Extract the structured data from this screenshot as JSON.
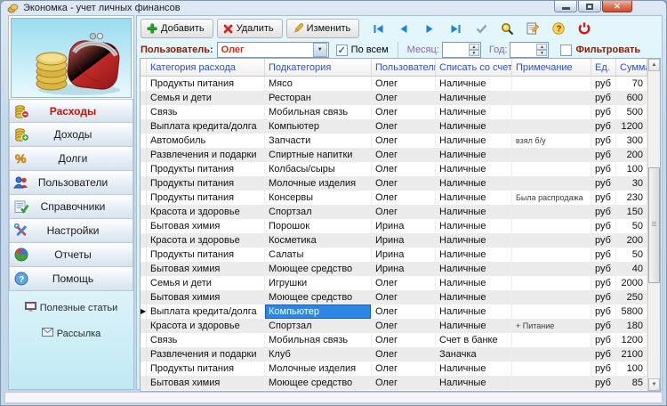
{
  "window": {
    "title": "Экономка - учет личных финансов"
  },
  "toolbar": {
    "buttons": [
      {
        "name": "add",
        "icon": "plus-icon",
        "label": "Добавить"
      },
      {
        "name": "delete",
        "icon": "x-icon",
        "label": "Удалить"
      },
      {
        "name": "edit",
        "icon": "pencil-icon",
        "label": "Изменить"
      }
    ],
    "nav_icons": [
      "first",
      "prev",
      "next",
      "last",
      "apply",
      "search",
      "edit-record",
      "help",
      "exit"
    ]
  },
  "filter": {
    "user_label": "Пользователь:",
    "user_value": "Олег",
    "by_all_label": "По всем",
    "by_all_checked": true,
    "month_label": "Месяц:",
    "month_value": "",
    "year_label": "Год:",
    "year_value": "",
    "filter_label": "Фильтровать",
    "filter_checked": false
  },
  "sidebar": {
    "items": [
      {
        "name": "expenses",
        "icon": "coins-minus-icon",
        "label": "Расходы",
        "active": true
      },
      {
        "name": "income",
        "icon": "coins-plus-icon",
        "label": "Доходы",
        "active": false
      },
      {
        "name": "debts",
        "icon": "percent-icon",
        "label": "Долги",
        "active": false
      },
      {
        "name": "users",
        "icon": "users-icon",
        "label": "Пользователи",
        "active": false
      },
      {
        "name": "references",
        "icon": "book-check-icon",
        "label": "Справочники",
        "active": false
      },
      {
        "name": "settings",
        "icon": "tools-icon",
        "label": "Настройки",
        "active": false
      },
      {
        "name": "reports",
        "icon": "pie-chart-icon",
        "label": "Отчеты",
        "active": false
      },
      {
        "name": "help",
        "icon": "question-icon",
        "label": "Помощь",
        "active": false
      }
    ],
    "links": [
      {
        "name": "useful-articles",
        "icon": "monitor-icon",
        "label": "Полезные статьи"
      },
      {
        "name": "newsletter",
        "icon": "envelope-icon",
        "label": "Рассылка"
      }
    ]
  },
  "table": {
    "columns": [
      "Категория расхода",
      "Подкатегория",
      "Пользователь",
      "Списать со счета",
      "Примечание",
      "Ед.",
      "Сумма"
    ],
    "rows": [
      [
        "Продукты питания",
        "Мясо",
        "Олег",
        "Наличные",
        "",
        "руб",
        "70"
      ],
      [
        "Семья и дети",
        "Ресторан",
        "Олег",
        "Наличные",
        "",
        "руб",
        "600"
      ],
      [
        "Связь",
        "Мобильная связь",
        "Олег",
        "Наличные",
        "",
        "руб",
        "500"
      ],
      [
        "Выплата кредита/долга",
        "Компьютер",
        "Олег",
        "Наличные",
        "",
        "руб",
        "1200"
      ],
      [
        "Автомобиль",
        "Запчасти",
        "Олег",
        "Наличные",
        "взял б/у",
        "руб",
        "300"
      ],
      [
        "Развлечения и подарки",
        "Спиртные напитки",
        "Олег",
        "Наличные",
        "",
        "руб",
        "200"
      ],
      [
        "Продукты питания",
        "Колбасы/сыры",
        "Олег",
        "Наличные",
        "",
        "руб",
        "100"
      ],
      [
        "Продукты питания",
        "Молочные изделия",
        "Олег",
        "Наличные",
        "",
        "руб",
        "30"
      ],
      [
        "Продукты питания",
        "Консервы",
        "Олег",
        "Наличные",
        "Была распродажа",
        "руб",
        "230"
      ],
      [
        "Красота и здоровье",
        "Спортзал",
        "Олег",
        "Наличные",
        "",
        "руб",
        "150"
      ],
      [
        "Бытовая химия",
        "Порошок",
        "Ирина",
        "Наличные",
        "",
        "руб",
        "50"
      ],
      [
        "Красота и здоровье",
        "Косметика",
        "Ирина",
        "Наличные",
        "",
        "руб",
        "200"
      ],
      [
        "Продукты питания",
        "Салаты",
        "Ирина",
        "Наличные",
        "",
        "руб",
        "50"
      ],
      [
        "Бытовая химия",
        "Моющее средство",
        "Ирина",
        "Наличные",
        "",
        "руб",
        "40"
      ],
      [
        "Семья и дети",
        "Игрушки",
        "Олег",
        "Наличные",
        "",
        "руб",
        "2000"
      ],
      [
        "Бытовая химия",
        "Моющее средство",
        "Олег",
        "Наличные",
        "",
        "руб",
        "250"
      ],
      [
        "Выплата кредита/долга",
        "Компьютер",
        "Олег",
        "Наличные",
        "",
        "руб",
        "5800"
      ],
      [
        "Красота и здоровье",
        "Спортзал",
        "Олег",
        "Наличные",
        "+ Питание",
        "руб",
        "180"
      ],
      [
        "Связь",
        "Мобильная связь",
        "Олег",
        "Счет в банке",
        "",
        "руб",
        "1200"
      ],
      [
        "Развлечения и подарки",
        "Клуб",
        "Олег",
        "Заначка",
        "",
        "руб",
        "2100"
      ],
      [
        "Продукты питания",
        "Молочные изделия",
        "Олег",
        "Наличные",
        "",
        "руб",
        "100"
      ],
      [
        "Бытовая химия",
        "Моющее средство",
        "Олег",
        "Наличные",
        "",
        "руб",
        "85"
      ]
    ],
    "selected_cell": {
      "row": 16,
      "col": 1
    }
  },
  "colors": {
    "selection": "#2e86e4",
    "active_item_text": "#cc1100",
    "header_text": "#2a52cc",
    "filter_label": "#8b1a00",
    "row_stripe": "#ebebeb"
  }
}
